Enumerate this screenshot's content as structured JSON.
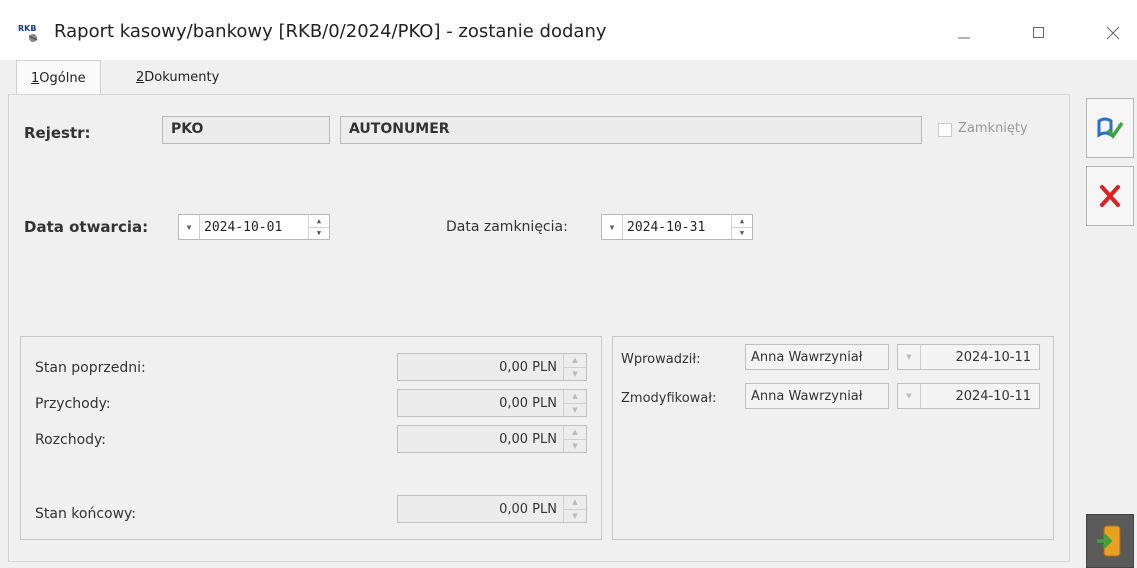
{
  "window": {
    "title": "Raport kasowy/bankowy [RKB/0/2024/PKO] - zostanie dodany",
    "icon_text": "RKB"
  },
  "tabs": [
    {
      "num": "1",
      "label": " Ogólne"
    },
    {
      "num": "2",
      "label": " Dokumenty"
    }
  ],
  "form": {
    "rejestr_label": "Rejestr:",
    "rejestr_code": "PKO",
    "rejestr_numbering": "AUTONUMER",
    "zamkniety_label": "Zamknięty",
    "data_otwarcia_label": "Data otwarcia:",
    "data_otwarcia_value": "2024-10-01",
    "data_zamkniecia_label": "Data zamknięcia:",
    "data_zamkniecia_value": "2024-10-31"
  },
  "balances": {
    "stan_poprzedni_label": "Stan poprzedni:",
    "stan_poprzedni_value": "0,00 PLN",
    "przychody_label": "Przychody:",
    "przychody_value": "0,00 PLN",
    "rozchody_label": "Rozchody:",
    "rozchody_value": "0,00 PLN",
    "stan_koncowy_label": "Stan końcowy:",
    "stan_koncowy_value": "0,00 PLN"
  },
  "audit": {
    "wprowadzil_label": "Wprowadził:",
    "wprowadzil_user": "Anna Wawrzyniał",
    "wprowadzil_date": "2024-10-11",
    "zmodyfikowal_label": "Zmodyfikował:",
    "zmodyfikowal_user": "Anna Wawrzyniał",
    "zmodyfikowal_date": "2024-10-11"
  },
  "colors": {
    "save_icon_blue": "#2a6fc9",
    "save_icon_green": "#3aa33a",
    "cancel_red": "#e02020"
  }
}
